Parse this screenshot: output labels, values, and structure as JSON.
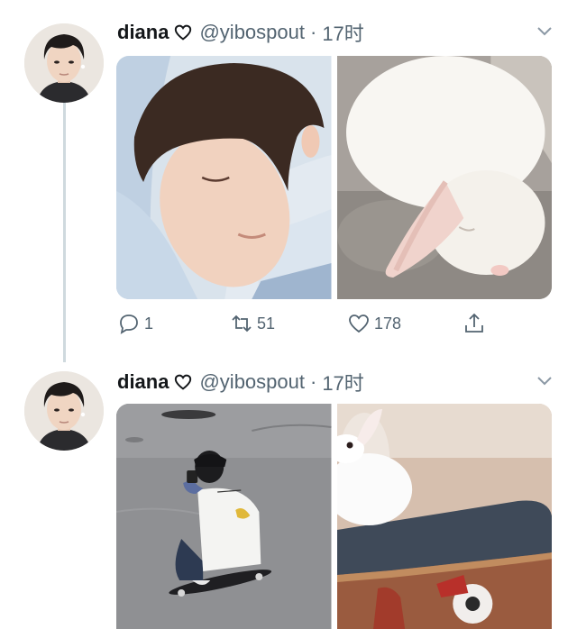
{
  "tweets": [
    {
      "name": "diana",
      "name_emoji": "heart-outline",
      "handle": "@yibospout",
      "separator": "·",
      "time": "17时",
      "media": [
        "sleeping-person-photo",
        "sleeping-white-rabbit-photo"
      ],
      "actions": {
        "reply_count": "1",
        "retweet_count": "51",
        "like_count": "178"
      }
    },
    {
      "name": "diana",
      "name_emoji": "heart-outline",
      "handle": "@yibospout",
      "separator": "·",
      "time": "17时",
      "media": [
        "person-on-skateboard-photo",
        "rabbit-on-skateboard-photo"
      ]
    }
  ],
  "colors": {
    "text_primary": "#14171a",
    "text_secondary": "#536471",
    "thread_line": "#cfd9de"
  }
}
